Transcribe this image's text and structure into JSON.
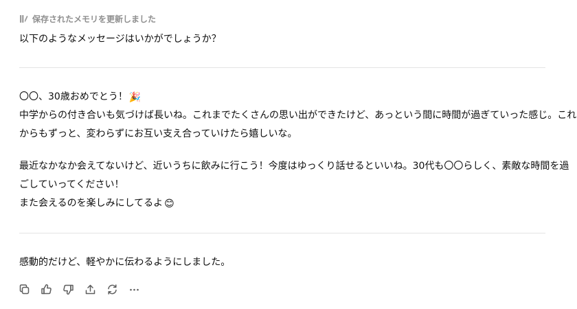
{
  "memory_note": {
    "icon": "memory-pencil-icon",
    "text": "保存されたメモリを更新しました"
  },
  "intro": "以下のようなメッセージはいかがでしょうか？",
  "message": {
    "paragraph1": [
      "〇〇、30歳おめでとう！",
      "中学からの付き合いも気づけば長いね。これまでたくさんの思い出ができたけど、あっという間に時間が過ぎていった感じ。これ",
      "からもずっと、変わらずにお互い支え合っていけたら嬉しいな。"
    ],
    "paragraph1_emoji": "🎉",
    "paragraph2": [
      "最近なかなか会えてないけど、近いうちに飲みに行こう！今度はゆっくり話せるといいね。30代も〇〇らしく、素敵な時間を過",
      "ごしていってください！",
      "また会えるのを楽しみにしてるよ"
    ],
    "paragraph2_emoji": "😊"
  },
  "closing": "感動的だけど、軽やかに伝わるようにしました。",
  "actions": [
    {
      "name": "copy-icon"
    },
    {
      "name": "thumbs-up-icon"
    },
    {
      "name": "thumbs-down-icon"
    },
    {
      "name": "share-icon"
    },
    {
      "name": "regenerate-icon"
    },
    {
      "name": "more-options-icon"
    }
  ],
  "colors": {
    "text": "#0d0d0d",
    "muted": "#8f8f8f",
    "divider": "#e3e3e3",
    "icon": "#5d5d5d"
  }
}
